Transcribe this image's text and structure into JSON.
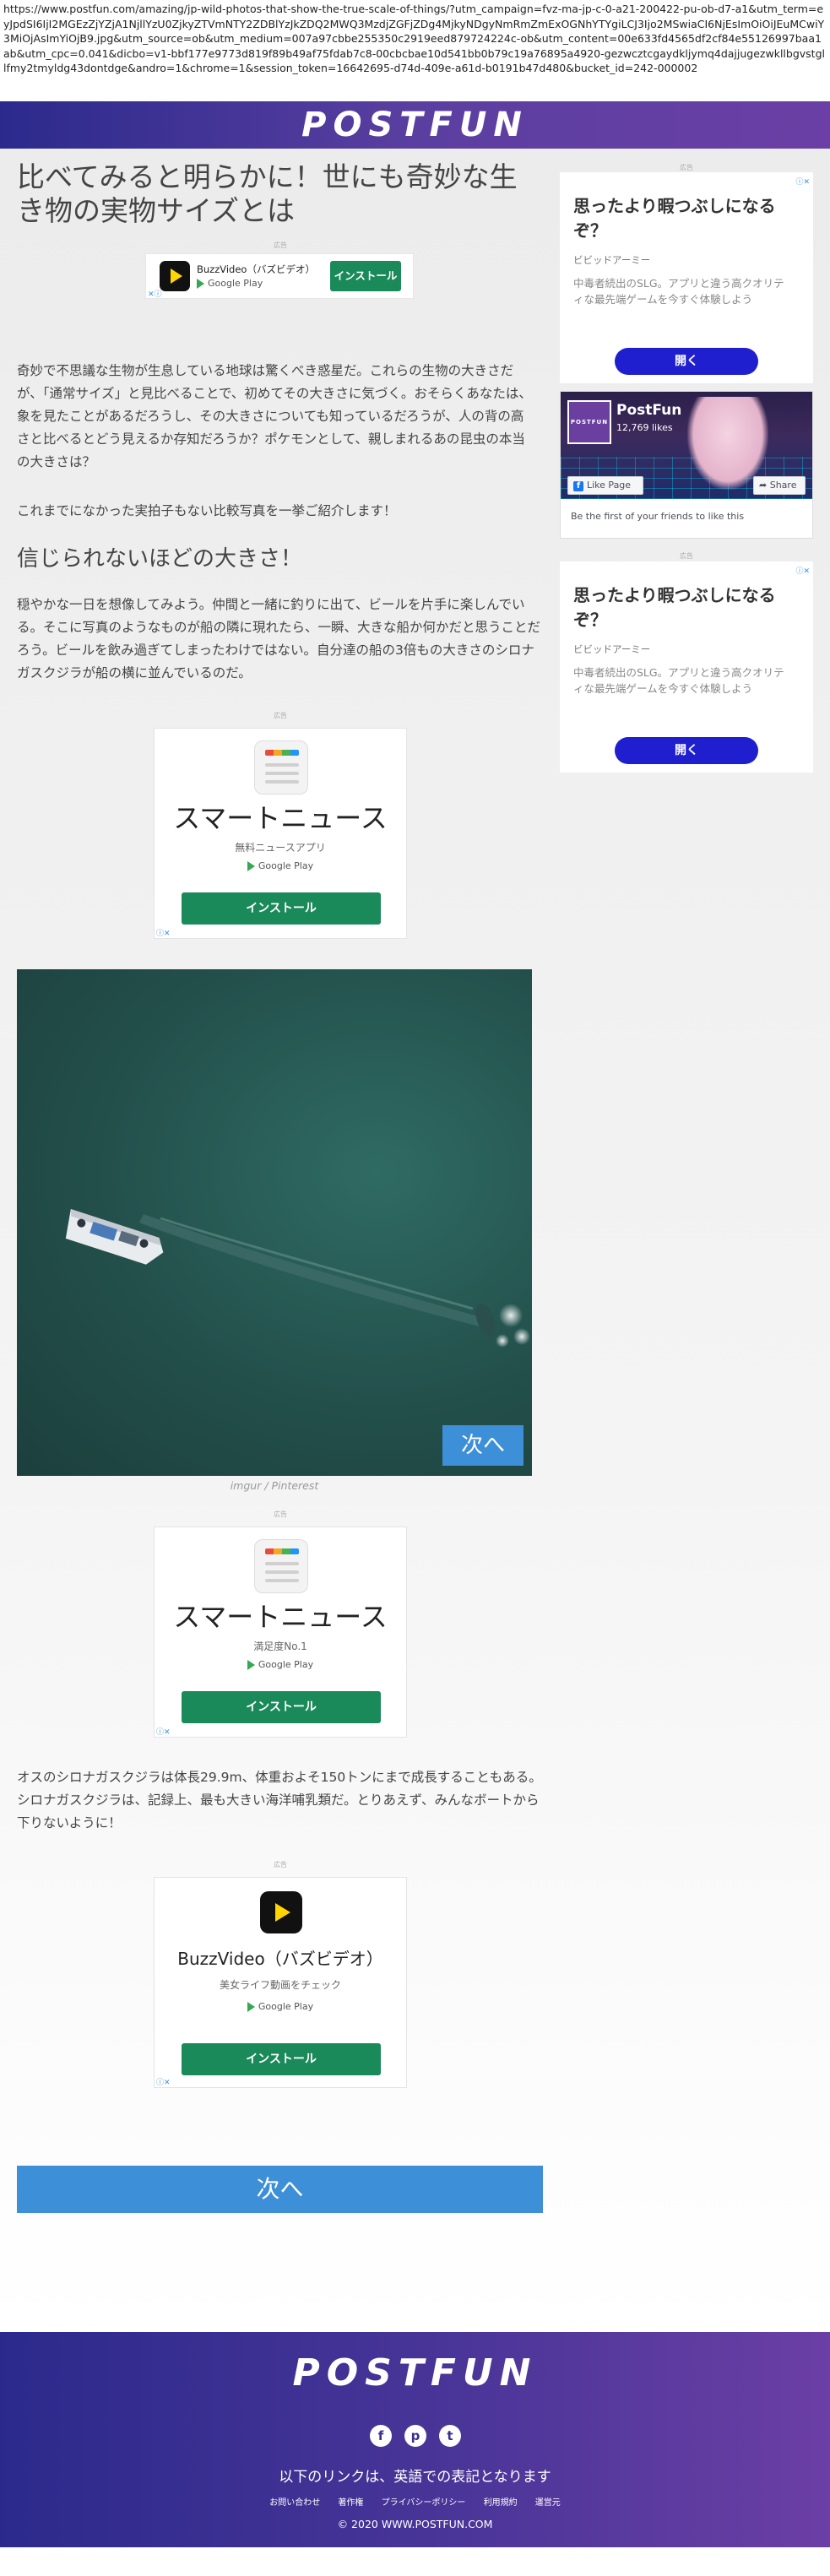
{
  "browser": {
    "url": "https://www.postfun.com/amazing/jp-wild-photos-that-show-the-true-scale-of-things/?utm_campaign=fvz-ma-jp-c-0-a21-200422-pu-ob-d7-a1&utm_term=eyJpdSI6IjI2MGEzZjYZjA1NjllYzU0ZjkyZTVmNTY2ZDBlYzJkZDQ2MWQ3MzdjZGFjZDg4MjkyNDgyNmRmZmExOGNhYTYgiLCJ3Ijo2MSwiaCI6NjEsImOiOiJEuMCwiY3MiOjAsImYiOjB9.jpg&utm_source=ob&utm_medium=007a97cbbe255350c2919eed879724224c-ob&utm_content=00e633fd4565df2cf84e55126997baa1ab&utm_cpc=0.041&dicbo=v1-bbf177e9773d819f89b49af75fdab7c8-00cbcbae10d541bb0b79c19a76895a4920-gezwcztcgaydkljymq4dajjugezwkllbgvstgllfmy2tmyldg43dontdge&andro=1&chrome=1&session_token=16642695-d74d-409e-a61d-b0191b47d480&bucket_id=242-000002"
  },
  "site": {
    "logo": "POSTFUN"
  },
  "article": {
    "title": "比べてみると明らかに！世にも奇妙な生き物の実物サイズとは",
    "intro": "奇妙で不思議な生物が生息している地球は驚くべき惑星だ。これらの生物の大きさだが、「通常サイズ」と見比べることで、初めてその大きさに気づく。おそらくあなたは、象を見たことがあるだろうし、その大きさについても知っているだろうが、人の背の高さと比べるとどう見えるか存知だろうか？ポケモンとして、親しまれるあの昆虫の本当の大きさは？",
    "intro2": "これまでになかった実拍子もない比較写真を一挙ご紹介します！",
    "section_title": "信じられないほどの大きさ！",
    "section_text": "穏やかな一日を想像してみよう。仲間と一緒に釣りに出て、ビールを片手に楽しんでいる。そこに写真のようなものが船の隣に現れたら、一瞬、大きな船か何かだと思うことだろう。ビールを飲み過ぎてしまったわけではない。自分達の船の3倍もの大きさのシロナガスクジラが船の横に並んでいるのだ。",
    "photo_credit": "imgur / Pinterest",
    "photo_next": "次へ",
    "caption": "オスのシロナガスクジラは体長29.9m、体重およそ150トンにまで成長することもある。シロナガスクジラは、記録上、最も大きい海洋哺乳類だ。とりあえず、みんなボートから下りないように！",
    "next_button": "次へ"
  },
  "ads": {
    "label": "広告",
    "banner": {
      "app_name": "BuzzVideo（バズビデオ）",
      "store": "Google Play",
      "install": "インストール"
    },
    "square1": {
      "title": "スマートニュース",
      "subtitle": "無料ニュースアプリ",
      "store": "Google Play",
      "install": "インストール"
    },
    "square2": {
      "title": "スマートニュース",
      "subtitle": "満足度No.1",
      "store": "Google Play",
      "install": "インストール"
    },
    "square3": {
      "title": "BuzzVideo（バズビデオ）",
      "subtitle": "美女ライフ動画をチェック",
      "store": "Google Play",
      "install": "インストール"
    },
    "sidebar1": {
      "title": "思ったより暇つぶしになるぞ？",
      "brand": "ビビッドアーミー",
      "desc": "中毒者続出のSLG。アプリと違う高クオリティな最先端ゲームを今すぐ体験しよう",
      "cta": "開く"
    },
    "sidebar2": {
      "title": "思ったより暇つぶしになるぞ？",
      "brand": "ビビッドアーミー",
      "desc": "中毒者続出のSLG。アプリと違う高クオリティな最先端ゲームを今すぐ体験しよう",
      "cta": "開く"
    }
  },
  "facebook": {
    "page_name": "PostFun",
    "likes": "12,769 likes",
    "like_button": "Like Page",
    "share_button": "Share",
    "friends_text": "Be the first of your friends to like this",
    "avatar_text": "POSTFUN"
  },
  "footer": {
    "note": "以下のリンクは、英語での表記となります",
    "links": [
      "お問い合わせ",
      "著作権",
      "プライバシーポリシー",
      "利用規約",
      "運営元"
    ],
    "copyright": "© 2020 WWW.POSTFUN.COM",
    "social": [
      "f",
      "p",
      "t"
    ]
  },
  "icons": [
    "play-icon",
    "google-play-icon",
    "adchoices-icon",
    "facebook-icon",
    "pinterest-icon",
    "twitter-icon",
    "share-icon"
  ],
  "colors": {
    "brand": "#3a2f90",
    "install": "#1b8a5a",
    "next": "#3d8fd8",
    "cta": "#1f1fd0"
  }
}
